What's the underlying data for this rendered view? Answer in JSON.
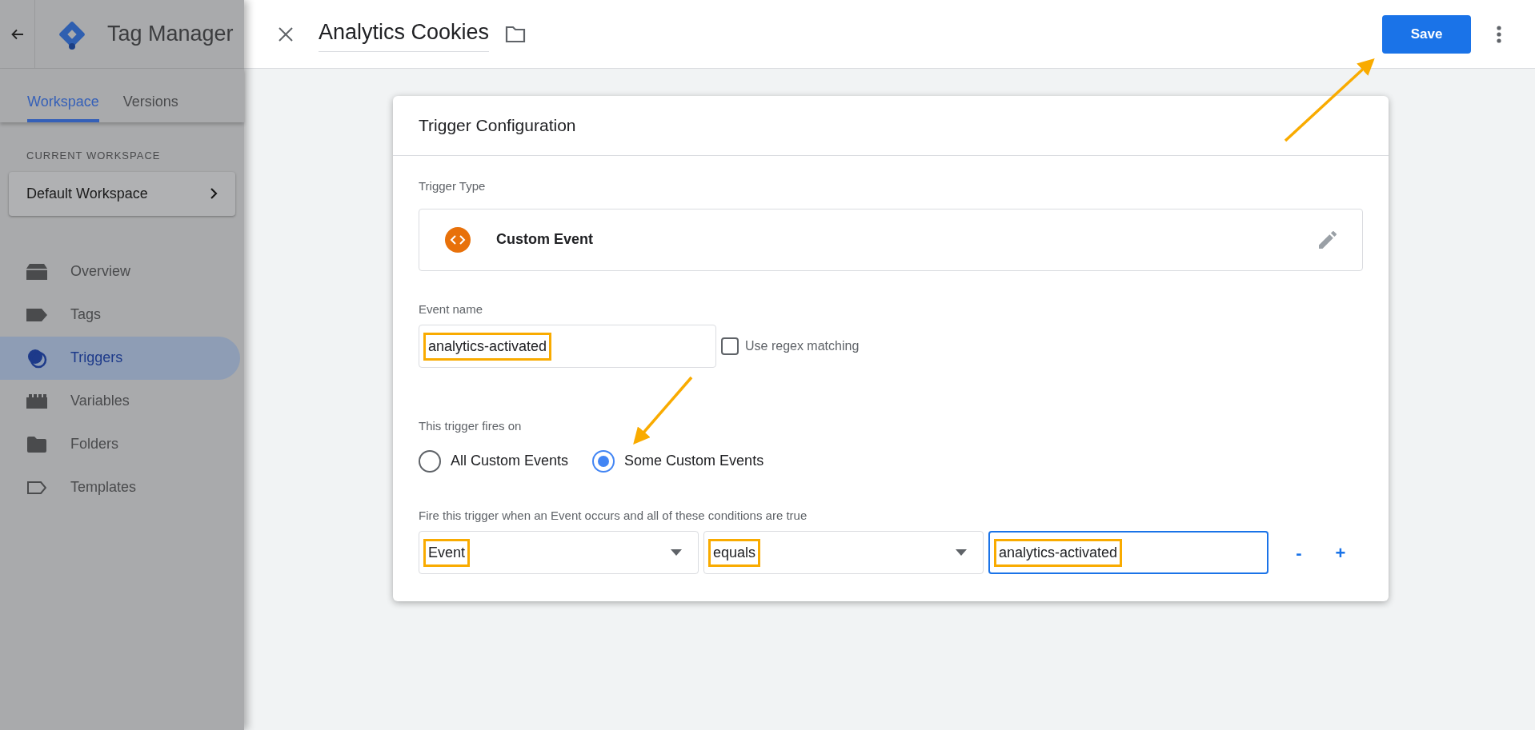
{
  "sidebar": {
    "title": "Tag Manager",
    "tabs": [
      {
        "label": "Workspace",
        "selected": true
      },
      {
        "label": "Versions",
        "selected": false
      }
    ],
    "workspace_label": "CURRENT WORKSPACE",
    "workspace": "Default Workspace",
    "nav": [
      {
        "label": "Overview",
        "kind": "overview",
        "selected": false
      },
      {
        "label": "Tags",
        "kind": "tag",
        "selected": false
      },
      {
        "label": "Triggers",
        "kind": "trigger",
        "selected": true
      },
      {
        "label": "Variables",
        "kind": "variable",
        "selected": false
      },
      {
        "label": "Folders",
        "kind": "folder",
        "selected": false
      },
      {
        "label": "Templates",
        "kind": "template",
        "selected": false
      }
    ]
  },
  "header": {
    "title": "Analytics Cookies",
    "save": "Save"
  },
  "card": {
    "title": "Trigger Configuration",
    "trigger_type_label": "Trigger Type",
    "trigger_type": "Custom Event",
    "event_name_label": "Event name",
    "event_name": {
      "value": "analytics-activated",
      "highlighted": true
    },
    "regex": {
      "label": "Use regex matching",
      "checked": false
    },
    "fires_on_label": "This trigger fires on",
    "fires_on": [
      {
        "label": "All Custom Events",
        "selected": false
      },
      {
        "label": "Some Custom Events",
        "selected": true
      }
    ],
    "condition_label": "Fire this trigger when an Event occurs and all of these conditions are true",
    "condition": [
      {
        "kind": "select",
        "value": "Event",
        "highlighted": true
      },
      {
        "kind": "select",
        "value": "equals",
        "highlighted": true
      },
      {
        "kind": "input",
        "value": "analytics-activated",
        "highlighted": true
      }
    ],
    "remove": "-",
    "add": "+"
  }
}
